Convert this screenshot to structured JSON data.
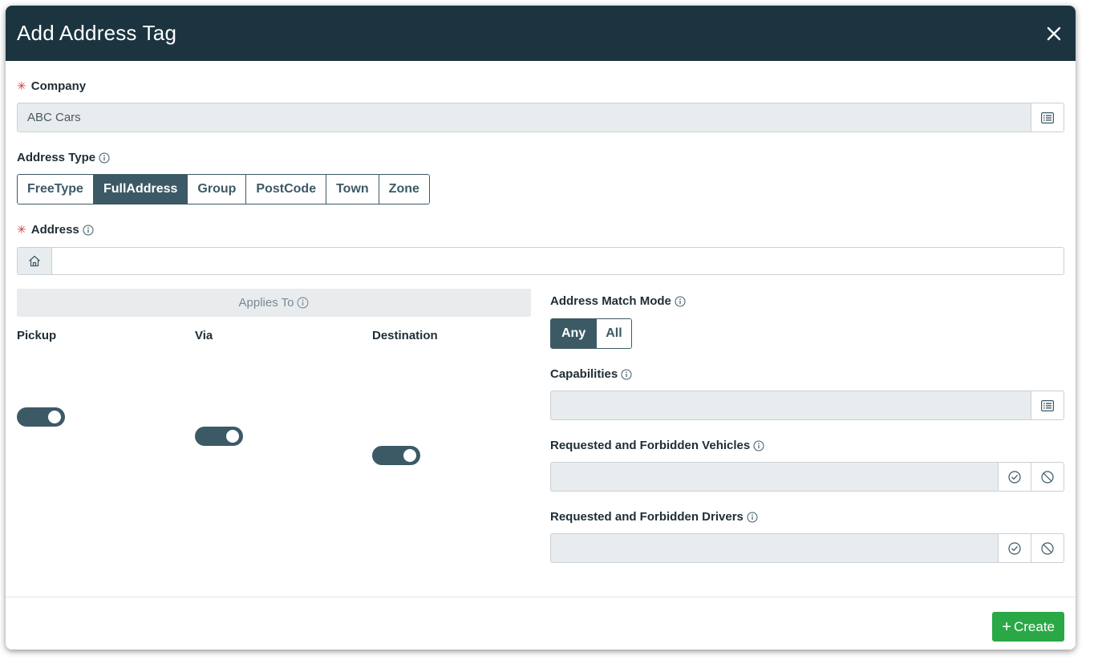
{
  "header": {
    "title": "Add Address Tag"
  },
  "company": {
    "label": "Company",
    "value": "ABC Cars"
  },
  "address_type": {
    "label": "Address Type",
    "options": [
      "FreeType",
      "FullAddress",
      "Group",
      "PostCode",
      "Town",
      "Zone"
    ],
    "selected": "FullAddress"
  },
  "address": {
    "label": "Address",
    "value": ""
  },
  "applies_to": {
    "label": "Applies To",
    "toggles": [
      {
        "label": "Pickup",
        "on": true
      },
      {
        "label": "Via",
        "on": true
      },
      {
        "label": "Destination",
        "on": true
      }
    ]
  },
  "match_mode": {
    "label": "Address Match Mode",
    "options": [
      "Any",
      "All"
    ],
    "selected": "Any"
  },
  "capabilities": {
    "label": "Capabilities",
    "value": ""
  },
  "vehicles": {
    "label": "Requested and Forbidden Vehicles",
    "value": ""
  },
  "drivers": {
    "label": "Requested and Forbidden Drivers",
    "value": ""
  },
  "footer": {
    "create_label": "Create"
  },
  "colors": {
    "header_bg": "#1b3440",
    "accent": "#3c5966",
    "create": "#2aa846",
    "required": "#d0393e"
  },
  "icons": [
    "close-icon",
    "list-icon",
    "info-icon",
    "home-icon",
    "check-circle-icon",
    "ban-icon",
    "plus-icon"
  ]
}
